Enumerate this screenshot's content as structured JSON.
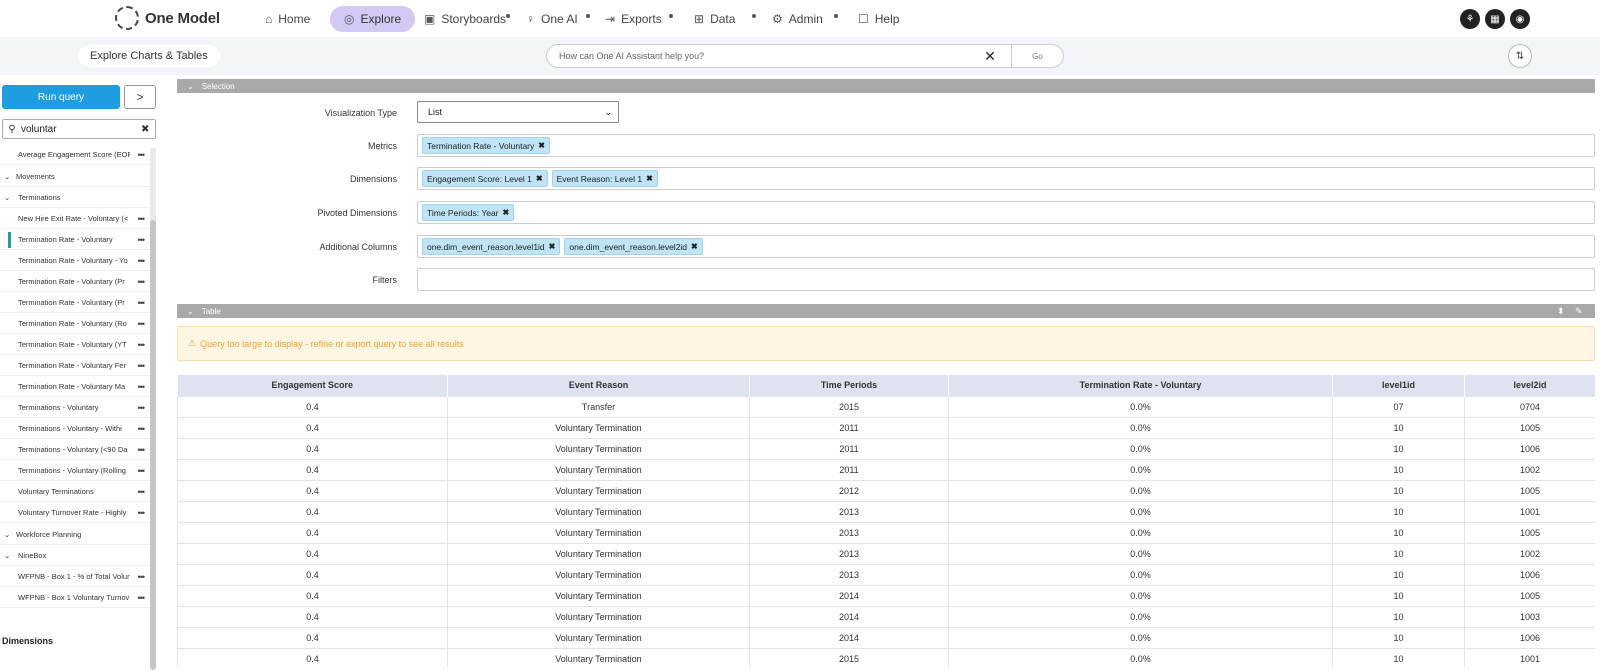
{
  "topnav": {
    "logo_text": "One Model",
    "items": [
      {
        "label": "Home",
        "icon": "home-icon"
      },
      {
        "label": "Explore",
        "icon": "compass-icon",
        "active": true
      },
      {
        "label": "Storyboards",
        "icon": "storyboard-icon"
      },
      {
        "label": "One AI",
        "icon": "lightbulb-icon"
      },
      {
        "label": "Exports",
        "icon": "export-icon"
      },
      {
        "label": "Data",
        "icon": "data-icon"
      },
      {
        "label": "Admin",
        "icon": "gear-icon"
      },
      {
        "label": "Help",
        "icon": "help-chat-icon"
      }
    ],
    "right_icons": [
      "org-chart-icon",
      "calendar-icon",
      "user-icon"
    ]
  },
  "subhead": {
    "title": "Explore Charts & Tables",
    "assistant_placeholder": "How can One AI Assistant help you?",
    "go_label": "Go"
  },
  "sidebar": {
    "run_query_label": "Run query",
    "expand_label": ">",
    "search_value": "voluntar",
    "items": [
      {
        "label": "Average Engagement Score (EOP",
        "type": "item"
      },
      {
        "label": "Movements",
        "type": "group"
      },
      {
        "label": "Terminations",
        "type": "group"
      },
      {
        "label": "New Hire Exit Rate - Voluntary (<",
        "type": "item"
      },
      {
        "label": "Termination Rate - Voluntary",
        "type": "item",
        "selected": true
      },
      {
        "label": "Termination Rate - Voluntary - Yo",
        "type": "item"
      },
      {
        "label": "Termination Rate - Voluntary (Pr",
        "type": "item"
      },
      {
        "label": "Termination Rate - Voluntary (Pr",
        "type": "item"
      },
      {
        "label": "Termination Rate - Voluntary (Ro",
        "type": "item"
      },
      {
        "label": "Termination Rate - Voluntary (YT",
        "type": "item"
      },
      {
        "label": "Termination Rate - Voluntary Fer",
        "type": "item"
      },
      {
        "label": "Termination Rate - Voluntary Ma",
        "type": "item"
      },
      {
        "label": "Terminations - Voluntary",
        "type": "item"
      },
      {
        "label": "Terminations - Voluntary - Withi",
        "type": "item"
      },
      {
        "label": "Terminations - Voluntary (<90 Da",
        "type": "item"
      },
      {
        "label": "Terminations - Voluntary (Rolling",
        "type": "item"
      },
      {
        "label": "Voluntary Terminations",
        "type": "item"
      },
      {
        "label": "Voluntary Turnover Rate - Highly",
        "type": "item"
      },
      {
        "label": "Workforce Planning",
        "type": "group"
      },
      {
        "label": "NineBox",
        "type": "group"
      },
      {
        "label": "WFPNB - Box 1 - % of Total Volun",
        "type": "item"
      },
      {
        "label": "WFPNB - Box 1 Voluntary Turnov",
        "type": "item"
      }
    ],
    "dimensions_label": "Dimensions"
  },
  "selection": {
    "section_label": "Selection",
    "vis_type_label": "Visualization Type",
    "vis_type_value": "List",
    "metrics_label": "Metrics",
    "metrics": [
      "Termination Rate - Voluntary"
    ],
    "dimensions_label": "Dimensions",
    "dimensions": [
      "Engagement Score: Level 1",
      "Event Reason: Level 1"
    ],
    "pivoted_label": "Pivoted Dimensions",
    "pivoted": [
      "Time Periods: Year"
    ],
    "additional_label": "Additional Columns",
    "additional": [
      "one.dim_event_reason.level1id",
      "one.dim_event_reason.level2id"
    ],
    "filters_label": "Filters"
  },
  "table": {
    "section_label": "Table",
    "warning": "Query too large to display - refine or export query to see all results",
    "columns": [
      "Engagement Score",
      "Event Reason",
      "Time Periods",
      "Termination Rate - Voluntary",
      "level1id",
      "level2id"
    ],
    "rows": [
      [
        "0.4",
        "Transfer",
        "2015",
        "0.0%",
        "07",
        "0704"
      ],
      [
        "0.4",
        "Voluntary Termination",
        "2011",
        "0.0%",
        "10",
        "1005"
      ],
      [
        "0.4",
        "Voluntary Termination",
        "2011",
        "0.0%",
        "10",
        "1006"
      ],
      [
        "0.4",
        "Voluntary Termination",
        "2011",
        "0.0%",
        "10",
        "1002"
      ],
      [
        "0.4",
        "Voluntary Termination",
        "2012",
        "0.0%",
        "10",
        "1005"
      ],
      [
        "0.4",
        "Voluntary Termination",
        "2013",
        "0.0%",
        "10",
        "1001"
      ],
      [
        "0.4",
        "Voluntary Termination",
        "2013",
        "0.0%",
        "10",
        "1005"
      ],
      [
        "0.4",
        "Voluntary Termination",
        "2013",
        "0.0%",
        "10",
        "1002"
      ],
      [
        "0.4",
        "Voluntary Termination",
        "2013",
        "0.0%",
        "10",
        "1006"
      ],
      [
        "0.4",
        "Voluntary Termination",
        "2014",
        "0.0%",
        "10",
        "1005"
      ],
      [
        "0.4",
        "Voluntary Termination",
        "2014",
        "0.0%",
        "10",
        "1003"
      ],
      [
        "0.4",
        "Voluntary Termination",
        "2014",
        "0.0%",
        "10",
        "1006"
      ],
      [
        "0.4",
        "Voluntary Termination",
        "2015",
        "0.0%",
        "10",
        "1001"
      ]
    ]
  },
  "colors": {
    "accent": "#1e9de0",
    "nav_active": "#d4c9f5",
    "chip": "#bfe4f5",
    "warning": "#f0a030",
    "section_bar": "#a9a9a9"
  }
}
